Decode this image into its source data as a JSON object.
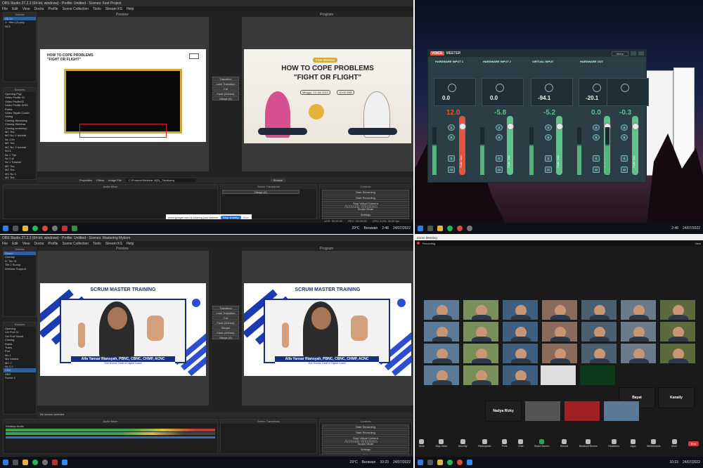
{
  "obs_top": {
    "window_title": "OBS Studio 27.2.3 (64-bit, windows) - Profile: Untitled - Scenes: Fest Project",
    "menu": [
      "File",
      "Edit",
      "View",
      "Docks",
      "Profile",
      "Scene Collection",
      "Tools",
      "Stream KS",
      "Help"
    ],
    "preview_label": "Preview",
    "program_label": "Program",
    "scenes_header": "Scenes",
    "scenes": [
      "Ok.12",
      "1 - Intro (3).png",
      "NC1"
    ],
    "sources_header": "Sources",
    "sources": [
      "Opening Prgl",
      "Video Profile 01",
      "Video Profile02",
      "Video Profile WSS",
      "Rubia",
      "Video Tagah Coach",
      "Ucting",
      "Closing Workshop",
      "Closing Webinar",
      "Closing workshop",
      "MC Tes",
      "MC No. 1 tutorial",
      "Nc 1 bh",
      "MC Tes",
      "MC No. 2 tutorial",
      "WC1",
      "Nc 1 Tlpt",
      "Nc 2 dl",
      "Nc 1 Tutorial",
      "MC Tes",
      "MC Tes",
      "MC No 3",
      "MC Tes",
      "Info management",
      "MC Tutorial",
      "SBSA"
    ],
    "transitions": [
      "Transition",
      "Luck Transition",
      "Cut",
      "Fade (300ms)",
      "Merge (0)"
    ],
    "slide_left_title": "HOW TO COPE PROBLEMS\n\"FIGHT OR FLIGHT\"",
    "slide_right": {
      "badge": "Free Webinar",
      "title_line1": "HOW TO COPE PROBLEMS",
      "title_line2": "\"FIGHT OR FLIGHT\"",
      "date": "Minggu, 24 Juli 2022",
      "time": "10.00 WIB"
    },
    "bottom_labels": {
      "audio_mixer": "Audio Mixer",
      "scene_transitions": "Scene Transitions",
      "controls": "Controls",
      "properties": "Properties",
      "filters": "Filters",
      "image_file": "Image File",
      "path": "C:/Fortune/Webinar 4/(5),_Tamfuanq",
      "browse": "Browse",
      "merge": "Merge (0)"
    },
    "controls": [
      "Start Streaming",
      "Start Recording",
      "Stop Virtual Camera",
      "Studio Mode",
      "Settings",
      "Exit"
    ],
    "notice": "meet.google.com is sharing your screen.",
    "stop_sharing": "Stop sharing",
    "hide": "Hide",
    "activate_windows": "Activate Windows",
    "status": {
      "live": "LIVE: 00:00:00",
      "rec": "REC: 00:00:00",
      "cpu": "CPU: 3.2%, 30.00 fps"
    },
    "tray": {
      "temp": "29°C",
      "weather": "Berawan",
      "time": "2:48",
      "date": "24/07/2022"
    }
  },
  "voicemeeter": {
    "brand": "VOICE",
    "brand2": "MEETER",
    "menu_label": "Menu",
    "strips": [
      {
        "title": "HARDWARE INPUT 1",
        "value": "12.0",
        "gain_label": "Fader Gain"
      },
      {
        "title": "HARDWARE INPUT 2",
        "value": "-5.8",
        "gain_label": "Fader Gain"
      },
      {
        "title": "VIRTUAL INPUT",
        "value": "-5.2",
        "gain_label": "Fader Gain"
      },
      {
        "title": "HARDWARE OUT",
        "value": "0.0",
        "gain_label": "Fader Gain"
      },
      {
        "title": "",
        "value": "-0.3",
        "gain_label": "Fader Gain"
      }
    ],
    "readouts": [
      "0.0",
      "0.0",
      "-94.1",
      "-20.1"
    ],
    "btn_a": "A",
    "btn_b": "B",
    "btn_s": "S",
    "btn_m": "M",
    "colors": {
      "red": "#e2553a",
      "green": "#5ec28c",
      "panel": "#2b3e45"
    },
    "tray": {
      "time": "2:48",
      "date": "24/07/2022"
    }
  },
  "obs_bottom": {
    "window_title": "OBS Studio 27.2.3 (64-bit, windows) - Profile: Untitled - Scenes: Mastering Mykom",
    "preview_label": "Preview",
    "program_label": "Program",
    "scenes_header": "Scenes",
    "scenes": [
      "Scrum",
      "Overlay",
      "IC Tile 01",
      "Tile 2 Sunup",
      "Webinar Support"
    ],
    "sources_header": "Sources",
    "sources": [
      "Opening",
      "Vid Prof 01",
      "Vid Prof Sizedi",
      "Closing",
      "Rubia",
      "Trans",
      "Pod",
      "Mc 1",
      "Mic tutorial",
      "MC 2",
      "Nc 2.2",
      "CNV",
      "SBS",
      "Scene 2"
    ],
    "slide_title": "SCRUM MASTER TRAINING",
    "speaker_name": "Alfa Yansar Riansyah, PBNC, CBNC, CHMP, ACNC",
    "speaker_role": "Vice Human Dealt of Digital Coach",
    "transitions": [
      "Transition",
      "Luck Transition",
      "Cut",
      "Fade (300ms)",
      "Stinger",
      "Fade (300ms)",
      "Merge (0)"
    ],
    "no_source": "No source selected",
    "audio_mixer": "Audio Mixer",
    "scene_transitions": "Scene Transitions",
    "controls_header": "Controls",
    "controls": [
      "Start Streaming",
      "Start Recording",
      "Stop Virtual Camera",
      "Studio Mode",
      "Settings",
      "Exit"
    ],
    "audio_track": "Desktop Audio",
    "activate_windows": "Activate Windows",
    "tray": {
      "temp": "29°C",
      "weather": "Berawan",
      "time": "10:23",
      "date": "24/07/2022"
    }
  },
  "zoom": {
    "title": "Zoom Meeting",
    "recording": "Recording",
    "view": "View",
    "names": [
      "Bayat",
      "Kanaliy",
      "Nadya Rizky"
    ],
    "toolbar": [
      "Mute",
      "Stop Video",
      "Security",
      "Participants",
      "Polls",
      "Chat",
      "Share Screen",
      "Record",
      "Breakout Rooms",
      "Reactions",
      "Apps",
      "Whiteboards",
      "More"
    ],
    "end": "End",
    "tray": {
      "time": "10:23",
      "date": "24/07/2022"
    }
  }
}
